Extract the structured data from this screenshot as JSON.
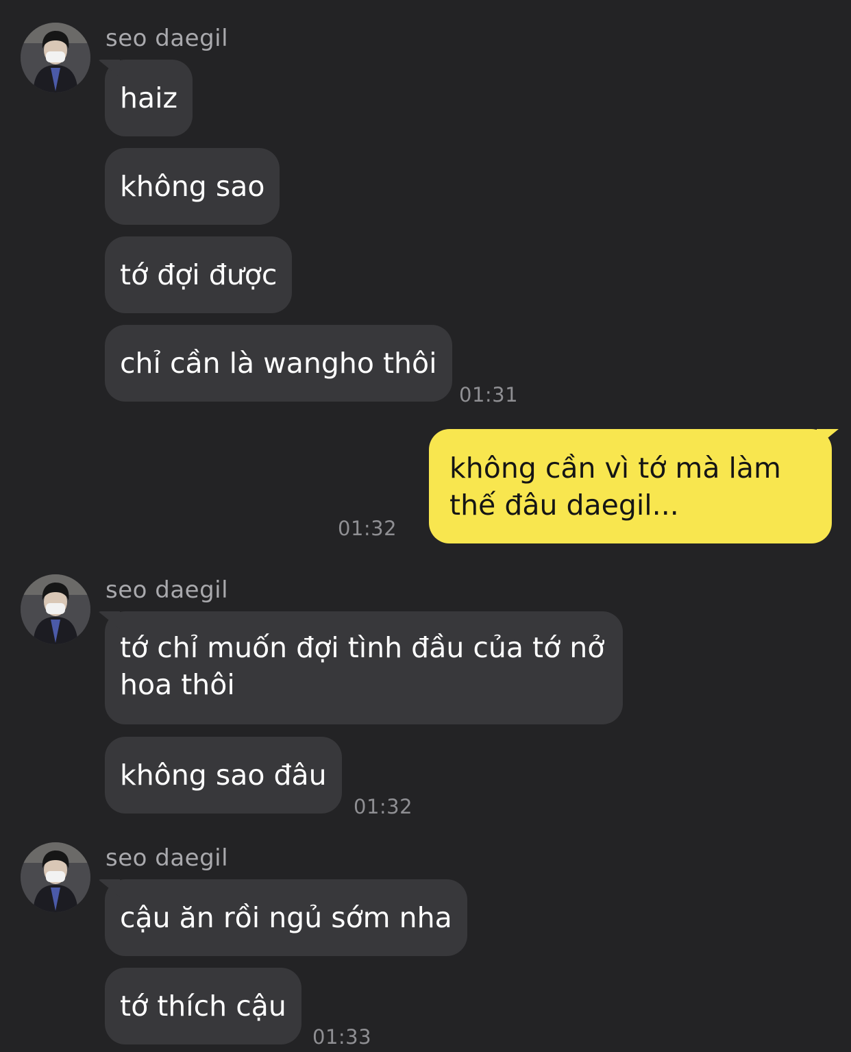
{
  "groups": [
    {
      "sender": "seo daegil",
      "avatar_icon": "profile-photo-icon",
      "messages": [
        "haiz",
        "không sao",
        "tớ đợi được",
        "chỉ cần là wangho thôi"
      ],
      "time": "01:31"
    },
    {
      "mine": true,
      "message": "không cần vì tớ mà làm thế đâu daegil...",
      "time": "01:32"
    },
    {
      "sender": "seo daegil",
      "avatar_icon": "profile-photo-icon",
      "messages": [
        "tớ chỉ muốn đợi tình đầu của tớ nở hoa thôi",
        "không sao đâu"
      ],
      "time": "01:32"
    },
    {
      "sender": "seo daegil",
      "avatar_icon": "profile-photo-icon",
      "messages": [
        "cậu ăn rồi ngủ sớm nha",
        "tớ thích cậu"
      ],
      "time": "01:33"
    }
  ],
  "colors": {
    "background": "#232325",
    "incoming_bubble": "#38383b",
    "outgoing_bubble": "#f8e64f",
    "timestamp": "#8f8f93"
  }
}
